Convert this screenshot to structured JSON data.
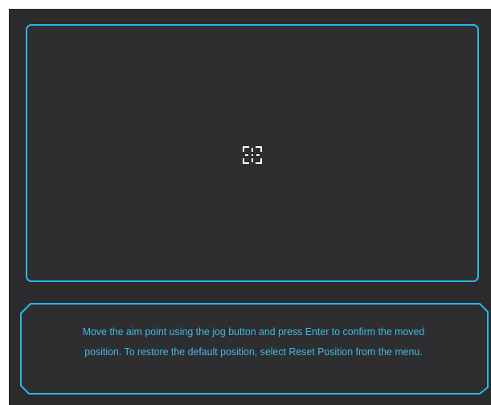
{
  "colors": {
    "accent": "#2ab7e6",
    "text": "#42b8e2",
    "background": "#2b2b2d",
    "crosshair": "#ffffff"
  },
  "preview": {
    "aim_icon": "crosshair-icon"
  },
  "message": {
    "line1": "Move the aim point using the jog button and press Enter to confirm the moved",
    "line2": "position. To restore the default position, select Reset Position from the menu."
  }
}
